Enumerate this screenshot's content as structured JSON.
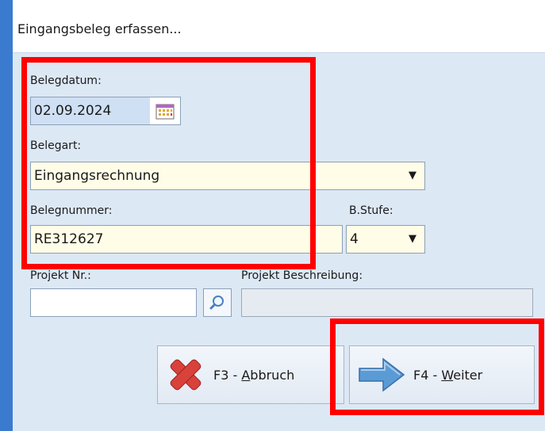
{
  "window": {
    "title": "Eingangsbeleg erfassen..."
  },
  "form": {
    "belegdatum": {
      "label": "Belegdatum:",
      "value": "02.09.2024"
    },
    "belegart": {
      "label": "Belegart:",
      "value": "Eingangsrechnung"
    },
    "belegnummer": {
      "label": "Belegnummer:",
      "value": "RE312627"
    },
    "bstufe": {
      "label": "B.Stufe:",
      "value": "4"
    },
    "projekt_nr": {
      "label": "Projekt Nr.:",
      "value": ""
    },
    "projekt_beschreibung": {
      "label": "Projekt Beschreibung:",
      "value": ""
    }
  },
  "buttons": {
    "abbruch": {
      "prefix": "F3 - ",
      "accel": "A",
      "rest": "bbruch"
    },
    "weiter": {
      "prefix": "F4 - ",
      "accel": "W",
      "rest": "eiter"
    }
  },
  "icons": {
    "calendar": "calendar-icon",
    "dropdown": "chevron-down-icon",
    "search": "magnifier-icon",
    "cancel": "red-x-icon",
    "next": "blue-arrow-icon"
  },
  "colors": {
    "desktop": "#3a7bd0",
    "dialog_bg": "#dde8f5",
    "field_bg": "#fffde7",
    "highlight": "#ff0000"
  }
}
